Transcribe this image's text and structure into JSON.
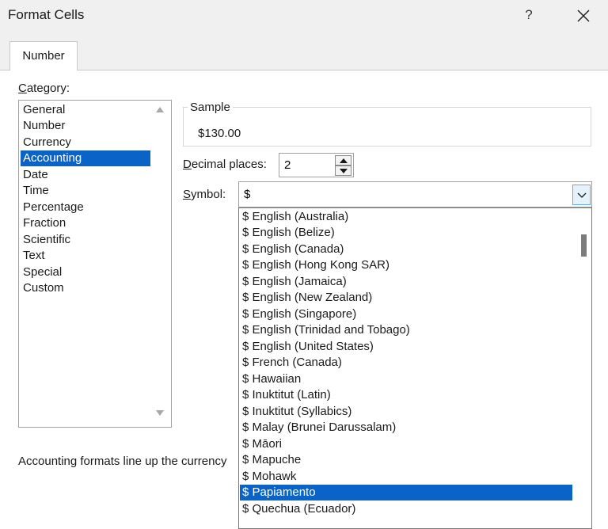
{
  "window": {
    "title": "Format Cells",
    "help_label": "?"
  },
  "tabs": [
    {
      "label": "Number"
    }
  ],
  "category": {
    "label_first": "C",
    "label_rest": "ategory:",
    "items": [
      "General",
      "Number",
      "Currency",
      "Accounting",
      "Date",
      "Time",
      "Percentage",
      "Fraction",
      "Scientific",
      "Text",
      "Special",
      "Custom"
    ],
    "selected": "Accounting"
  },
  "sample": {
    "legend": "Sample",
    "value": "$130.00"
  },
  "decimal": {
    "label_first": "D",
    "label_rest": "ecimal places:",
    "value": "2"
  },
  "symbol": {
    "label_first": "S",
    "label_rest": "ymbol:",
    "value": "$",
    "options": [
      "$ English (Australia)",
      "$ English (Belize)",
      "$ English (Canada)",
      "$ English (Hong Kong SAR)",
      "$ English (Jamaica)",
      "$ English (New Zealand)",
      "$ English (Singapore)",
      "$ English (Trinidad and Tobago)",
      "$ English (United States)",
      "$ French (Canada)",
      "$ Hawaiian",
      "$ Inuktitut (Latin)",
      "$ Inuktitut (Syllabics)",
      "$ Malay (Brunei Darussalam)",
      "$ Māori",
      "$ Mapuche",
      "$ Mohawk",
      "$ Papiamento",
      "$ Quechua (Ecuador)"
    ],
    "highlighted": "$ Papiamento"
  },
  "description": "Accounting formats line up the currency",
  "colors": {
    "selection": "#0a64c8",
    "dialog_bg": "#f0f0f0",
    "panel_bg": "#ffffff"
  }
}
